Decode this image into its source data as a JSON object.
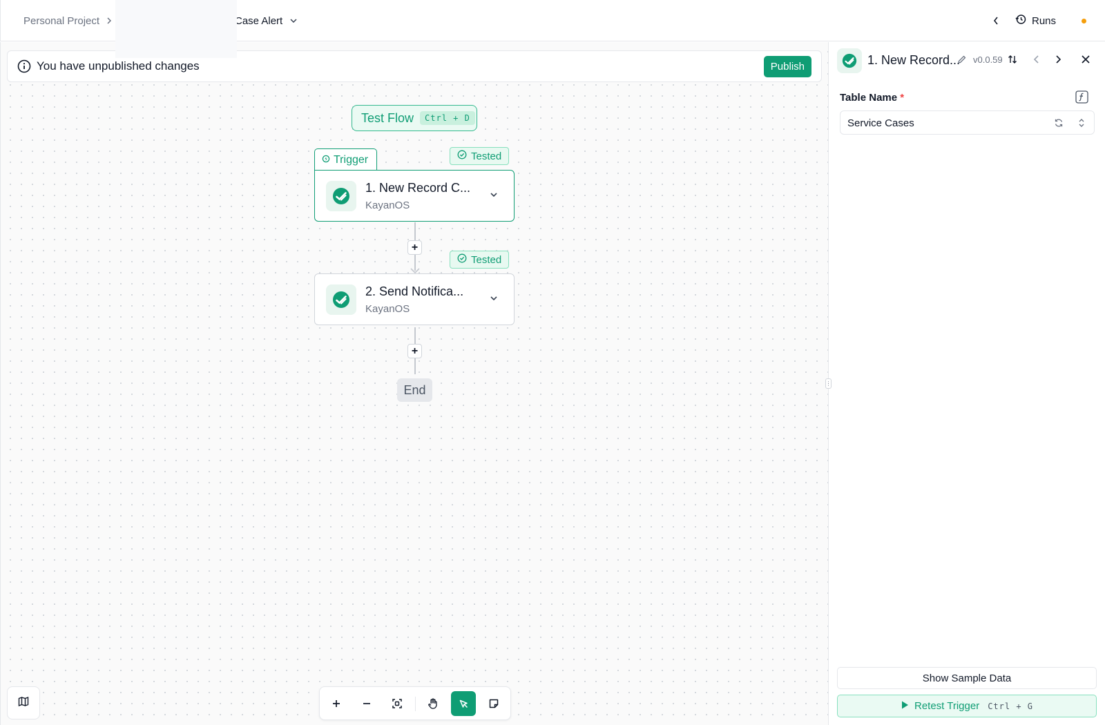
{
  "header": {
    "project": "Personal Project",
    "flow_name": "Case Alert",
    "runs_label": "Runs"
  },
  "banner": {
    "message": "You have unpublished changes",
    "publish_label": "Publish"
  },
  "canvas": {
    "test_flow_label": "Test Flow",
    "test_flow_shortcut": "Ctrl + D",
    "trigger_tab_label": "Trigger",
    "steps": [
      {
        "title": "1. New Record C...",
        "app": "KayanOS",
        "status": "Tested"
      },
      {
        "title": "2. Send Notifica...",
        "app": "KayanOS",
        "status": "Tested"
      }
    ],
    "end_label": "End"
  },
  "panel": {
    "title": "1. New Record...",
    "version": "v0.0.59",
    "field_label": "Table Name",
    "field_required_mark": "*",
    "field_value": "Service Cases",
    "sample_data_label": "Show Sample Data",
    "retest_label": "Retest Trigger",
    "retest_shortcut": "Ctrl + G"
  },
  "colors": {
    "accent": "#0f9d74",
    "accent_light": "#eafaf3",
    "required": "#ef4444",
    "status_dot": "#f59e0b"
  },
  "icons": {
    "banner": "info-icon",
    "runs": "history-icon",
    "step_logo": "kayanos-logo-icon",
    "toolbar": [
      "zoom-in-icon",
      "zoom-out-icon",
      "fit-view-icon",
      "hand-pan-icon",
      "pointer-select-icon",
      "note-icon"
    ],
    "map": "map-icon"
  }
}
